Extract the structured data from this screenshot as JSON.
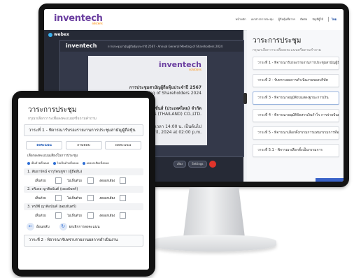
{
  "monitor": {
    "site_logo": "inventech",
    "site_logo_sub": "solutions",
    "nav": [
      "หน้าหลัก",
      "เอกสารการประชุม",
      "ผู้ถือหุ้นที่ฝากฯ",
      "ติดต่อ",
      "บัญชีผู้ใช้"
    ],
    "lang": "ไทย",
    "webex_label": "webex",
    "stream_logo": "inventech",
    "stream_title": "การประชุมสามัญผู้ถือหุ้นประจำปี 2567 · Annual General Meeting of Shareholders 2024",
    "slide": {
      "logo": "inventech",
      "logo_sub": "solutions",
      "line1": "การประชุมสามัญผู้ถือหุ้นประจำปี 2567",
      "line2": "Annual General Meeting of Shareholders 2024",
      "line3": "บริษัท อินเวนท์เทค โซลูชั่นส์ (ประเทศไทย) จำกัด",
      "line4": "INVENTECH SOLUTIONS (THAILAND) CO.,LTD.",
      "line5": "วันที่ 17 เมษายน 2567 เวลา 14:00 น. เป็นต้นไป",
      "line6": "Wednesday 17 April, 2024 at 02:00 p.m."
    },
    "controls": [
      "เสียง",
      "Settings"
    ],
    "agenda": {
      "title": "วาระการประชุม",
      "subtitle": "กรุณาเลือกวาระเพื่อลงคะแนนหรือถามคำถาม",
      "items": [
        "วาระที่ 1 - พิจารณารับรองรายงานการประชุมสามัญผู้ถือหุ้น",
        "วาระที่ 2 - รับทราบผลการดำเนินงานของบริษัท",
        "วาระที่ 3 - พิจารณาอนุมัติงบแสดงฐานะการเงิน",
        "วาระที่ 4 - พิจารณาอนุมัติจัดสรรเงินกำไร การจ่ายปันผล",
        "วาระที่ 5 - พิจารณาเลือกตั้งกรรมการแทนกรรมการที่ออก",
        "วาระที่ 5.1 - พิจารณาเลือกตั้งเป็นกรรมการ"
      ]
    }
  },
  "tablet": {
    "title": "วาระการประชุม",
    "subtitle": "กรุณาเลือกวาระเพื่อลงคะแนนหรือถามคำถาม",
    "active_agenda": "วาระที่ 1 - พิจารณารับรองรายงานการประชุมสามัญผู้ถือหุ้น",
    "buttons": [
      "ลงคะแนน",
      "ถามตอบ",
      "ผลคะแนน"
    ],
    "choose_label": "เลือกลงคะแนนเสียงในการประชุม",
    "radios": [
      "เห็นด้วยทั้งหมด",
      "ไม่เห็นด้วยทั้งหมด",
      "งดออกเสียงทั้งหมด"
    ],
    "vote_options": [
      "เห็นด้วย",
      "ไม่เห็นด้วย",
      "งดออกเสียง"
    ],
    "candidates": [
      "1. สันธารัตน์ จารุรัตนชูชา (ผู้ถือหุ้น)",
      "2. ดริเดล ญาติอนันต์ (ผอบธันทร์)",
      "3. ทรงีพี ญาติอนันต์ (ผอบธันทร์)"
    ],
    "actions": [
      "ย้อนกลับ",
      "ยกเลิกการลงคะแนน"
    ],
    "next_agenda": "วาระที่ 2 - พิจารณารับทราบรายงานผลการดำเนินงาน"
  }
}
